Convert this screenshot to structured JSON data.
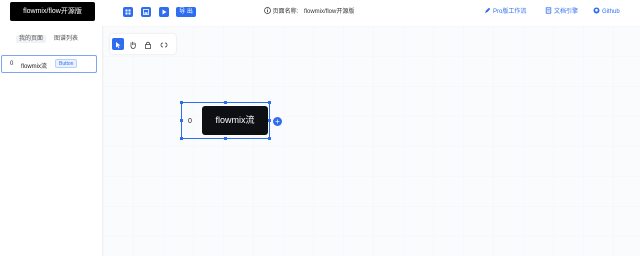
{
  "header": {
    "logo": "flowmix/flow开源版",
    "toolbar": {
      "export_label": "导 出"
    },
    "page_name_label": "页面名称:",
    "page_name_value": "flowmix/flow开源版",
    "links": [
      {
        "label": "Pro版工作流",
        "icon": "pen-icon"
      },
      {
        "label": "文档引擎",
        "icon": "doc-icon"
      },
      {
        "label": "Github",
        "icon": "github-icon"
      }
    ],
    "accent": "#2f6df0"
  },
  "sidebar": {
    "tabs": [
      "我的页面",
      "图谱列表"
    ],
    "items": [
      {
        "index": "0",
        "name": "flowmix流",
        "type": "Button"
      }
    ]
  },
  "canvas": {
    "tools": [
      "select-tool",
      "hand-tool",
      "lock-tool",
      "link-tool"
    ],
    "node": {
      "index": "0",
      "label": "flowmix流",
      "add": "+"
    }
  }
}
